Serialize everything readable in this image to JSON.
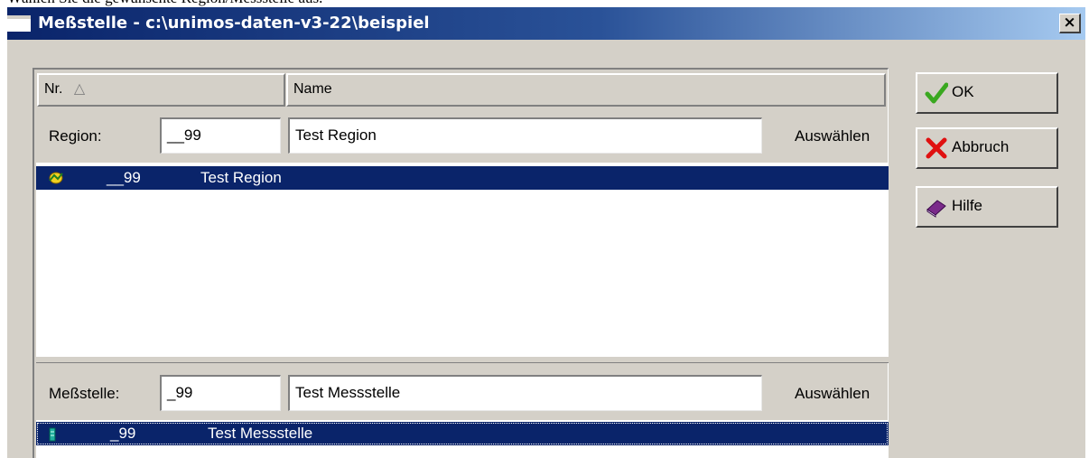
{
  "document": {
    "instruction_text": "Wählen Sie die gewünschte Region/Messstelle aus."
  },
  "window": {
    "title": "Meßstelle - c:\\unimos-daten-v3-22\\beispiel",
    "close_label": "×"
  },
  "columns": {
    "nr": "Nr.",
    "nr_sort_indicator": "△",
    "name": "Name"
  },
  "region": {
    "label": "Region:",
    "nr_value": "__99",
    "name_value": "Test Region",
    "select_label": "Auswählen",
    "list": [
      {
        "icon": "region-icon",
        "nr": "__99",
        "name": "Test Region",
        "selected": true
      }
    ]
  },
  "station": {
    "label": "Meßstelle:",
    "nr_value": "_99",
    "name_value": "Test Messstelle",
    "select_label": "Auswählen",
    "list": [
      {
        "icon": "station-icon",
        "nr": "_99",
        "name": "Test Messstelle",
        "selected": true
      }
    ]
  },
  "buttons": {
    "ok": "OK",
    "cancel": "Abbruch",
    "help": "Hilfe"
  },
  "colors": {
    "selection": "#0a246a",
    "dialog_face": "#d4d0c8",
    "ok_check": "#3aa820",
    "cancel_x": "#e01010",
    "help_book": "#7a2a8a"
  }
}
